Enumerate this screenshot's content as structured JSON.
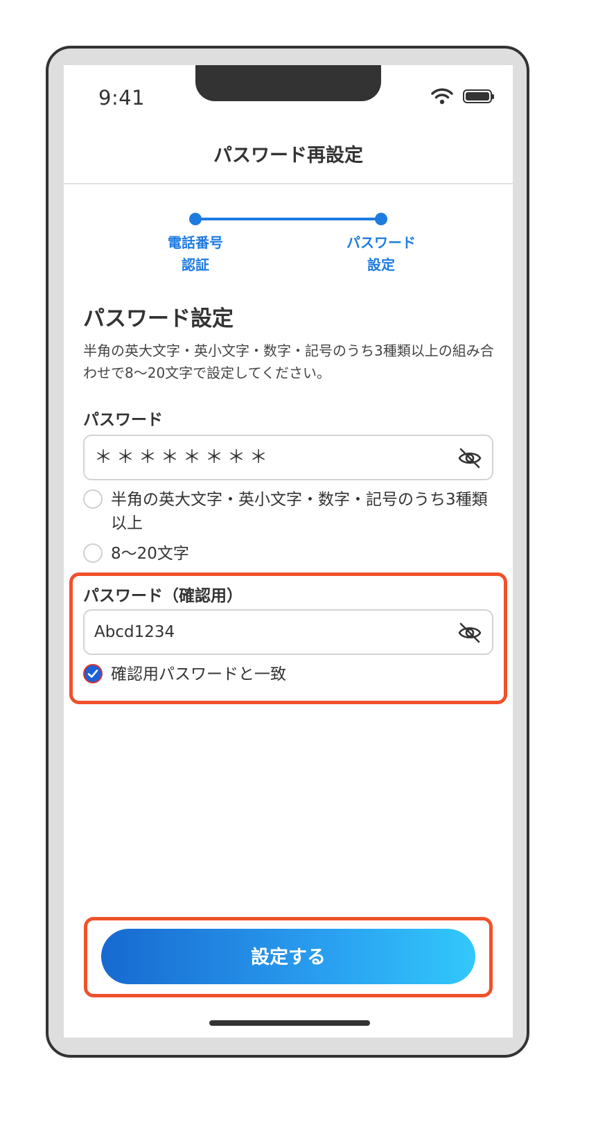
{
  "status_bar": {
    "time": "9:41"
  },
  "nav": {
    "title": "パスワード再設定"
  },
  "steps": [
    {
      "label_line1": "電話番号",
      "label_line2": "認証"
    },
    {
      "label_line1": "パスワード",
      "label_line2": "設定"
    }
  ],
  "section": {
    "title": "パスワード設定",
    "description": "半角の英大文字・英小文字・数字・記号のうち3種類以上の組み合わせで8〜20文字で設定してください。"
  },
  "password": {
    "label": "パスワード",
    "value": "＊＊＊＊＊＊＊＊",
    "rules": [
      {
        "text": "半角の英大文字・英小文字・数字・記号のうち3種類以上",
        "checked": false
      },
      {
        "text": "8〜20文字",
        "checked": false
      }
    ]
  },
  "confirm": {
    "label": "パスワード（確認用）",
    "value": "Abcd1234",
    "match_text": "確認用パスワードと一致",
    "match_checked": true
  },
  "submit": {
    "label": "設定する"
  },
  "colors": {
    "accent": "#1e7be0",
    "highlight": "#f0512a",
    "gradient_start": "#1769d0",
    "gradient_end": "#32c8fb"
  }
}
